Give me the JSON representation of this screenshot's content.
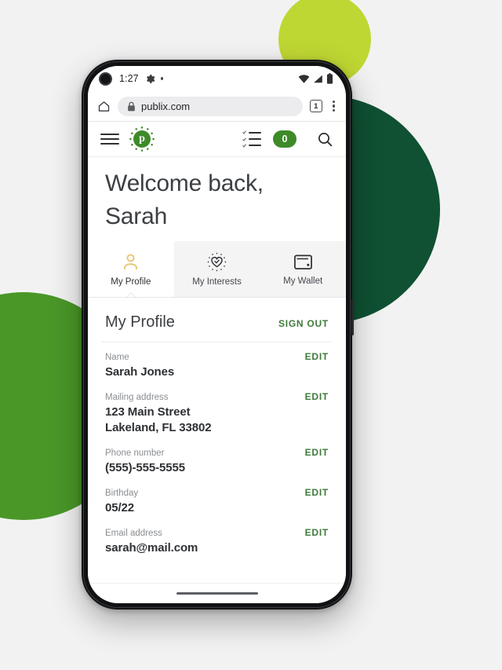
{
  "background": {
    "page_color": "#f2f2f2",
    "shapes": [
      {
        "name": "lime-circle",
        "color": "#bfd733"
      },
      {
        "name": "dark-green-circle",
        "color": "#0f5132"
      },
      {
        "name": "green-circle",
        "color": "#4a9728"
      }
    ]
  },
  "status_bar": {
    "time": "1:27",
    "icons": [
      "gear-icon",
      "dot-indicator",
      "wifi-icon",
      "signal-icon",
      "battery-icon"
    ]
  },
  "browser": {
    "home_icon": "home-icon",
    "lock_icon": "lock-icon",
    "url": "publix.com",
    "tab_count": "1",
    "menu_icon": "kebab-menu-icon"
  },
  "app_header": {
    "menu_icon": "hamburger-menu-icon",
    "logo_letter": "p",
    "logo_name": "publix-logo",
    "list_icon": "shopping-list-icon",
    "cart_count": "0",
    "search_icon": "search-icon",
    "accent_green": "#3e8a29"
  },
  "welcome": {
    "line1": "Welcome back,",
    "line2": "Sarah"
  },
  "tabs": [
    {
      "label": "My Profile",
      "icon": "person-icon",
      "active": true,
      "icon_color": "#e8c77a"
    },
    {
      "label": "My Interests",
      "icon": "heart-check-icon",
      "active": false,
      "icon_color": "#2e3033"
    },
    {
      "label": "My Wallet",
      "icon": "wallet-icon",
      "active": false,
      "icon_color": "#2e3033"
    }
  ],
  "profile": {
    "title": "My Profile",
    "sign_out_label": "SIGN OUT",
    "edit_label": "EDIT",
    "link_green": "#3e7a3a",
    "fields": [
      {
        "label": "Name",
        "value": "Sarah Jones",
        "value2": ""
      },
      {
        "label": "Mailing address",
        "value": "123 Main Street",
        "value2": "Lakeland, FL 33802"
      },
      {
        "label": "Phone number",
        "value": "(555)-555-5555",
        "value2": ""
      },
      {
        "label": "Birthday",
        "value": "05/22",
        "value2": ""
      },
      {
        "label": "Email address",
        "value": "sarah@mail.com",
        "value2": ""
      }
    ]
  },
  "gesture_bar": {
    "name": "android-gesture-handle"
  }
}
